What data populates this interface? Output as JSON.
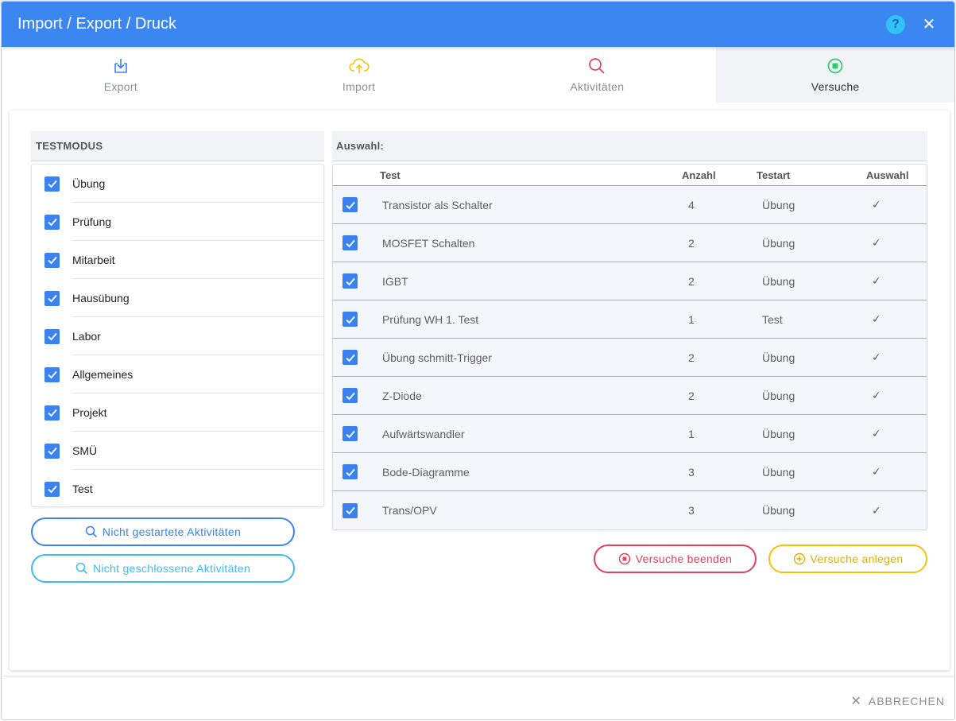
{
  "dialog": {
    "title": "Import / Export / Druck",
    "help_icon": "question-circle-icon",
    "close_icon": "close-icon",
    "header_color": "#3b86f0"
  },
  "tabs": [
    {
      "label": "Export",
      "icon": "download-icon",
      "color": "#3b82f0"
    },
    {
      "label": "Import",
      "icon": "cloud-upload-icon",
      "color": "#f4c20d"
    },
    {
      "label": "Aktivitäten",
      "icon": "search-icon",
      "color": "#e0435a"
    },
    {
      "label": "Versuche",
      "icon": "stop-circle-icon",
      "color": "#2ecc71",
      "active": true
    }
  ],
  "testmodus": {
    "heading": "TESTMODUS",
    "items": [
      {
        "label": "Übung",
        "checked": true
      },
      {
        "label": "Prüfung",
        "checked": true
      },
      {
        "label": "Mitarbeit",
        "checked": true
      },
      {
        "label": "Hausübung",
        "checked": true
      },
      {
        "label": "Labor",
        "checked": true
      },
      {
        "label": "Allgemeines",
        "checked": true
      },
      {
        "label": "Projekt",
        "checked": true
      },
      {
        "label": "SMÜ",
        "checked": true
      },
      {
        "label": "Test",
        "checked": true
      }
    ],
    "buttons": {
      "not_started": "Nicht gestartete Aktivitäten",
      "not_closed": "Nicht geschlossene Aktivitäten"
    }
  },
  "auswahl": {
    "heading": "Auswahl:",
    "columns": {
      "test": "Test",
      "anzahl": "Anzahl",
      "testart": "Testart",
      "auswahl": "Auswahl"
    },
    "rows": [
      {
        "test": "Transistor als Schalter",
        "anzahl": "4",
        "testart": "Übung",
        "auswahl": "✓"
      },
      {
        "test": "MOSFET Schalten",
        "anzahl": "2",
        "testart": "Übung",
        "auswahl": "✓"
      },
      {
        "test": "IGBT",
        "anzahl": "2",
        "testart": "Übung",
        "auswahl": "✓"
      },
      {
        "test": "Prüfung WH 1. Test",
        "anzahl": "1",
        "testart": "Test",
        "auswahl": "✓"
      },
      {
        "test": "Übung schmitt-Trigger",
        "anzahl": "2",
        "testart": "Übung",
        "auswahl": "✓"
      },
      {
        "test": "Z-Diode",
        "anzahl": "2",
        "testart": "Übung",
        "auswahl": "✓"
      },
      {
        "test": "Aufwärtswandler",
        "anzahl": "1",
        "testart": "Übung",
        "auswahl": "✓"
      },
      {
        "test": "Bode-Diagramme",
        "anzahl": "3",
        "testart": "Übung",
        "auswahl": "✓"
      },
      {
        "test": "Trans/OPV",
        "anzahl": "3",
        "testart": "Übung",
        "auswahl": "✓"
      }
    ],
    "buttons": {
      "end": "Versuche beenden",
      "create": "Versuche anlegen"
    }
  },
  "footer": {
    "cancel": "ABBRECHEN"
  }
}
